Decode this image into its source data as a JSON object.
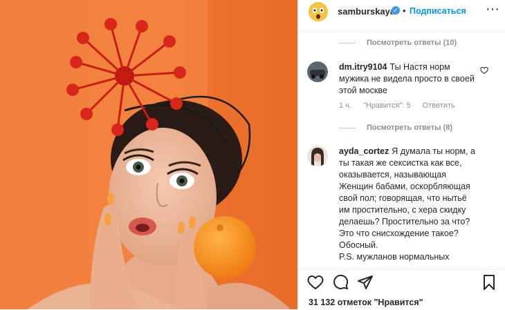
{
  "post": {
    "username": "samburskaya",
    "follow_label": "Подписаться",
    "dot": "•",
    "more": "···",
    "likes_text": "31 132 отметок \"Нравится\""
  },
  "comments": {
    "view_replies_1": "Посмотреть ответы (10)",
    "view_replies_2": "Посмотреть ответы (8)",
    "items": [
      {
        "username": "dm.itry9104",
        "text": "Ты Настя норм мужика не видела просто в своей этой москве",
        "time": "1 ч.",
        "likes": "\"Нравится\": 5",
        "reply": "Ответить"
      },
      {
        "username": "ayda_cortez",
        "text": "Я думала ты норм, а ты такая же сексистка как все, оказывается, называющая Женщин бабами, оскорбляющая свой пол; говорящая, что нытьё им простительно, с хера скидку делаешь? Простительно за что? Это что снисхождение такое? Обосный.",
        "text2": "P.S. мужланов нормальных"
      }
    ]
  },
  "colors": {
    "accent": "#0095f6",
    "verified": "#3897f0",
    "photo_bg": "#f07a3a"
  },
  "icons": [
    "heart-icon",
    "comment-icon",
    "share-icon",
    "bookmark-icon",
    "more-icon",
    "verified-icon"
  ]
}
